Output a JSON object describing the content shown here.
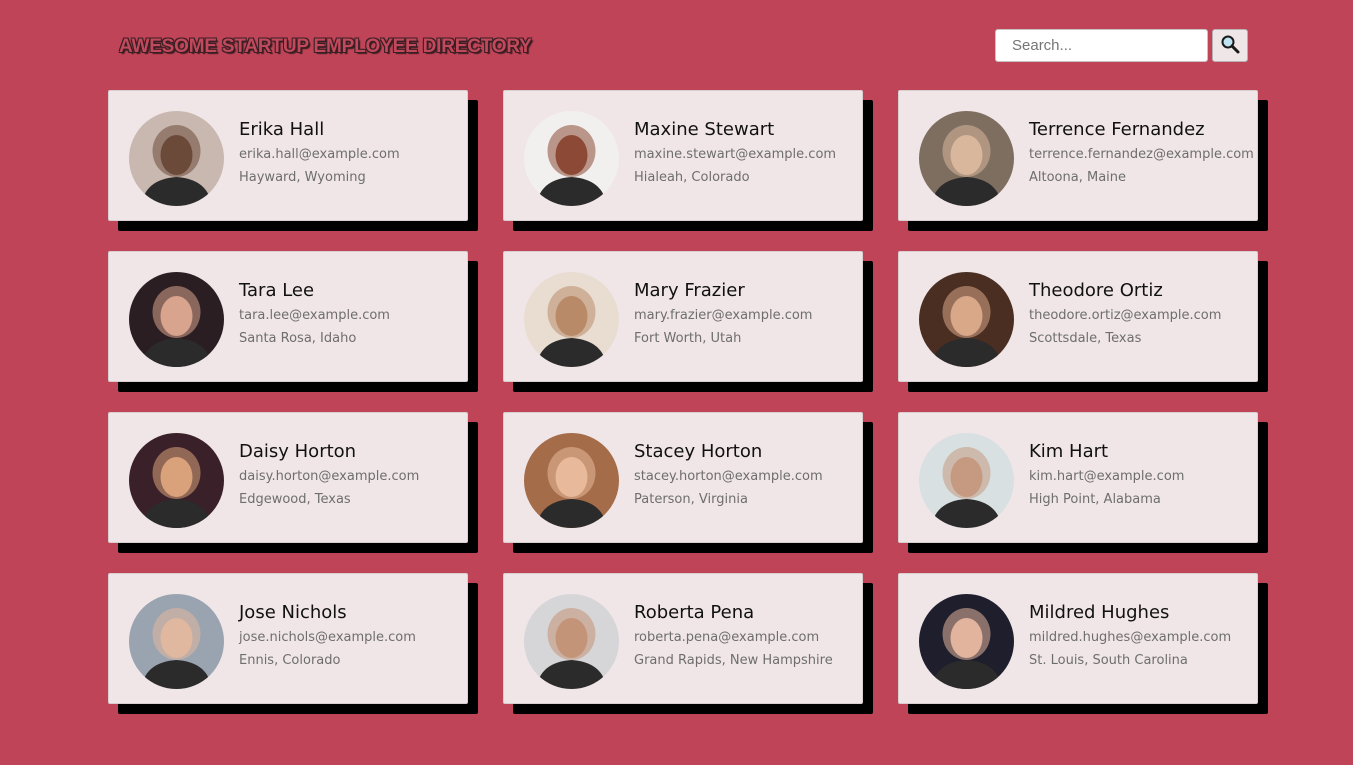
{
  "header": {
    "title": "AWESOME STARTUP EMPLOYEE DIRECTORY"
  },
  "search": {
    "placeholder": "Search...",
    "value": "",
    "button_icon": "magnifier-icon"
  },
  "employees": [
    {
      "name": "Erika Hall",
      "email": "erika.hall@example.com",
      "location": "Hayward, Wyoming",
      "avatar_bg": "#c9b8b0",
      "avatar_fg": "#6b4a3a"
    },
    {
      "name": "Maxine Stewart",
      "email": "maxine.stewart@example.com",
      "location": "Hialeah, Colorado",
      "avatar_bg": "#f2f0ee",
      "avatar_fg": "#8c4a36"
    },
    {
      "name": "Terrence Fernandez",
      "email": "terrence.fernandez@example.com",
      "location": "Altoona, Maine",
      "avatar_bg": "#7e6e60",
      "avatar_fg": "#d9b79c"
    },
    {
      "name": "Tara Lee",
      "email": "tara.lee@example.com",
      "location": "Santa Rosa, Idaho",
      "avatar_bg": "#2a1e22",
      "avatar_fg": "#d9a48e"
    },
    {
      "name": "Mary Frazier",
      "email": "mary.frazier@example.com",
      "location": "Fort Worth, Utah",
      "avatar_bg": "#e9ddd2",
      "avatar_fg": "#b98a68"
    },
    {
      "name": "Theodore Ortiz",
      "email": "theodore.ortiz@example.com",
      "location": "Scottsdale, Texas",
      "avatar_bg": "#4a2e22",
      "avatar_fg": "#d8a889"
    },
    {
      "name": "Daisy Horton",
      "email": "daisy.horton@example.com",
      "location": "Edgewood, Texas",
      "avatar_bg": "#3a2028",
      "avatar_fg": "#d9a27a"
    },
    {
      "name": "Stacey Horton",
      "email": "stacey.horton@example.com",
      "location": "Paterson, Virginia",
      "avatar_bg": "#a56c4a",
      "avatar_fg": "#e8b99a"
    },
    {
      "name": "Kim Hart",
      "email": "kim.hart@example.com",
      "location": "High Point, Alabama",
      "avatar_bg": "#d8e0e2",
      "avatar_fg": "#c59a80"
    },
    {
      "name": "Jose Nichols",
      "email": "jose.nichols@example.com",
      "location": "Ennis, Colorado",
      "avatar_bg": "#9aa3b0",
      "avatar_fg": "#e0b8a0"
    },
    {
      "name": "Roberta Pena",
      "email": "roberta.pena@example.com",
      "location": "Grand Rapids, New Hampshire",
      "avatar_bg": "#d6d6d8",
      "avatar_fg": "#c49478"
    },
    {
      "name": "Mildred Hughes",
      "email": "mildred.hughes@example.com",
      "location": "St. Louis, South Carolina",
      "avatar_bg": "#1e1e2c",
      "avatar_fg": "#e2b49e"
    }
  ]
}
